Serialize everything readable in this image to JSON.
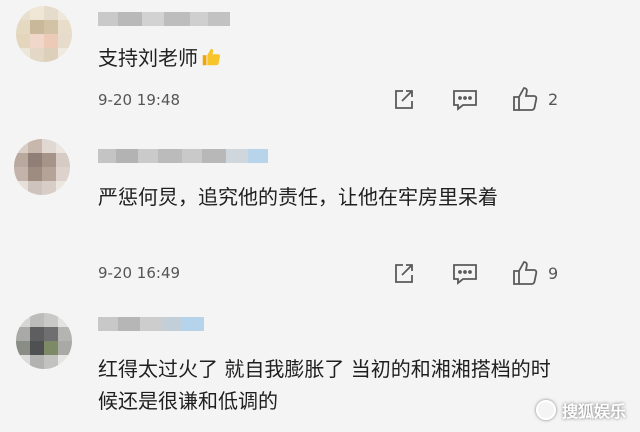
{
  "comments": [
    {
      "text": "支持刘老师",
      "emoji": "thumbs-up-emoji",
      "time": "9-20 19:48",
      "likes": "2"
    },
    {
      "text": "严惩何炅，追究他的责任，让他在牢房里呆着",
      "time": "9-20 16:49",
      "likes": "9"
    },
    {
      "text": "红得太过火了 就自我膨胀了 当初的和湘湘搭档的时候还是很谦和低调的"
    }
  ],
  "icons": {
    "share": "share-icon",
    "reply": "reply-icon",
    "like": "thumbs-up-icon"
  },
  "watermark": {
    "label": "搜狐娱乐"
  },
  "colors": {
    "background": "#f4f4f4",
    "text": "#1f1f1f",
    "meta": "#555555",
    "emoji": "#f5b400"
  }
}
